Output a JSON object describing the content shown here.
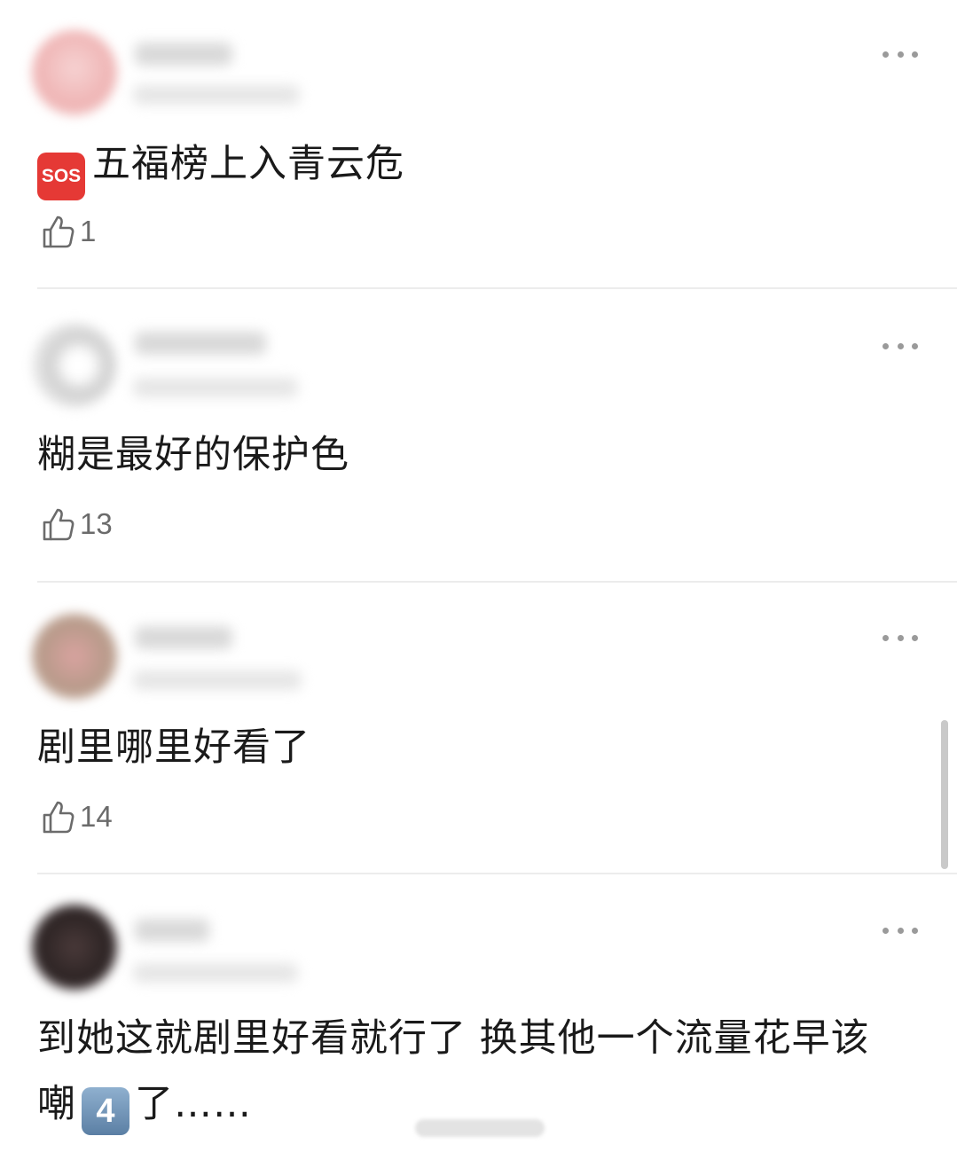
{
  "comments": [
    {
      "emoji_label": "SOS",
      "text": "五福榜上入青云危",
      "likes": "1"
    },
    {
      "text": "糊是最好的保护色",
      "likes": "13"
    },
    {
      "text": "剧里哪里好看了",
      "likes": "14"
    },
    {
      "text_line1": "到她这就剧里好看就行了 换其他一个流量花早该",
      "text_line2_before": "嘲",
      "keycap": "4",
      "text_line2_after": "了……"
    }
  ],
  "colors": {
    "sos_red": "#e53935",
    "keycap_blue": "#6f93b9",
    "text": "#1a1a1a",
    "muted": "#6b6b6b"
  },
  "icons": [
    "more-icon",
    "thumbs-up-icon",
    "sos-emoji-icon",
    "keycap-4-emoji-icon"
  ]
}
